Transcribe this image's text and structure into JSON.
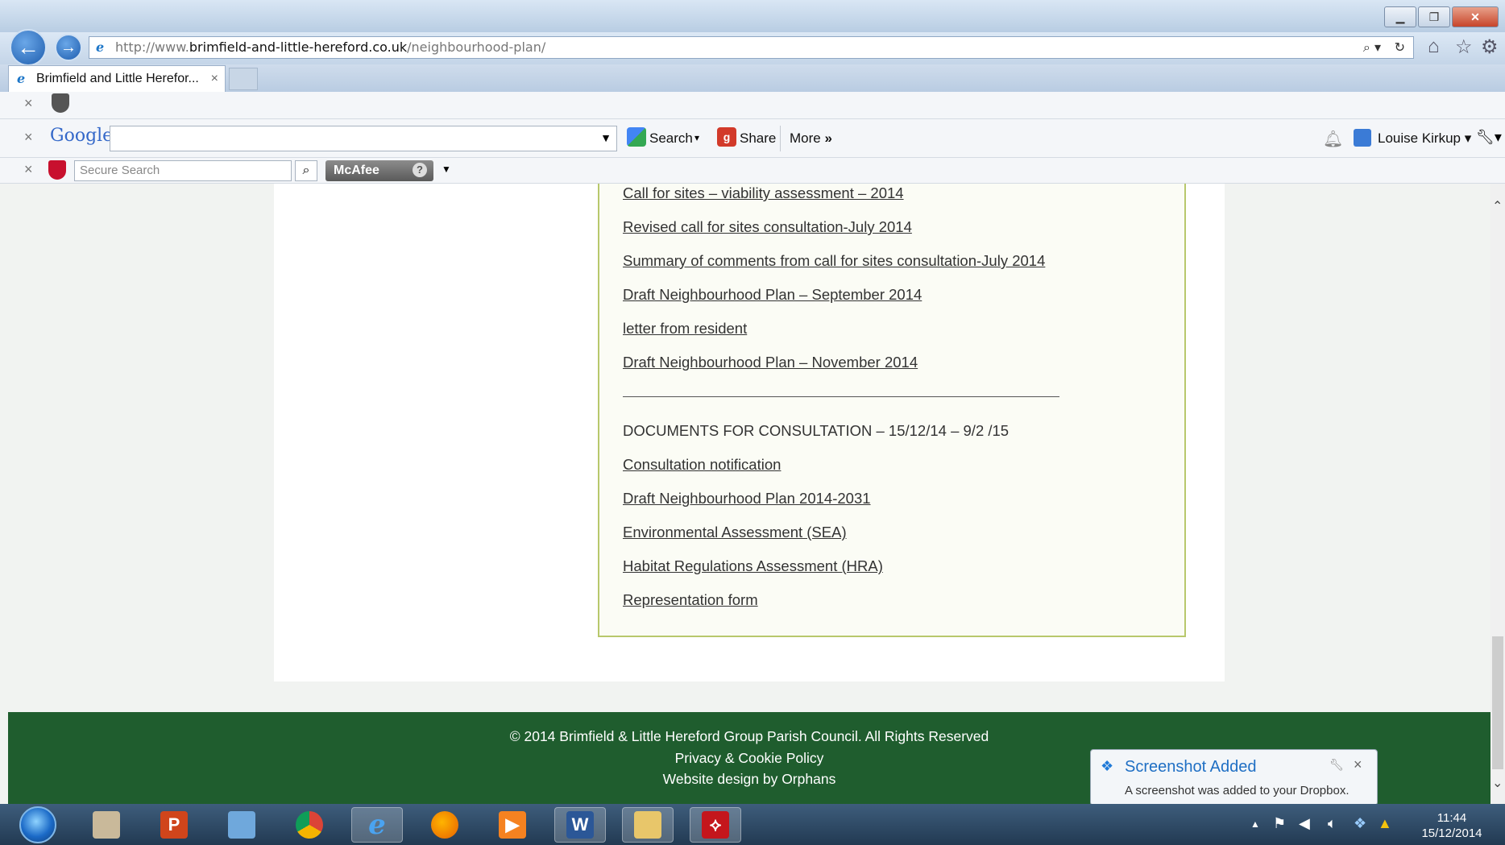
{
  "browser": {
    "url_prefix": "http://www.",
    "url_domain": "brimfield-and-little-hereford.co.uk",
    "url_path": "/neighbourhood-plan/",
    "tab_title": "Brimfield and Little Herefor...",
    "tab_close": "×"
  },
  "toolbar": {
    "close_glyph": "×",
    "google_logo": "Google",
    "search_label": "Search",
    "share_label": "Share",
    "more_label": "More",
    "user_name": "Louise Kirkup",
    "secure_search_placeholder": "Secure Search",
    "mcafee_label": "McAfee"
  },
  "content": {
    "links_top": [
      "Call for sites – viability assessment – 2014",
      "Revised call for sites consultation-July 2014",
      "Summary of comments from call for sites consultation-July 2014",
      "Draft Neighbourhood Plan – September 2014",
      "letter from resident",
      "Draft Neighbourhood Plan – November 2014"
    ],
    "section_heading": "DOCUMENTS FOR CONSULTATION – 15/12/14 – 9/2 /15",
    "links_bottom": [
      "Consultation notification",
      "Draft Neighbourhood Plan 2014-2031",
      "Environmental Assessment (SEA)",
      "Habitat Regulations Assessment (HRA)",
      "Representation form"
    ]
  },
  "footer": {
    "copyright": "© 2014 Brimfield & Little Hereford Group Parish Council. All Rights Reserved",
    "privacy": "Privacy & Cookie Policy",
    "design": "Website design by Orphans"
  },
  "notification": {
    "title": "Screenshot Added",
    "body": "A screenshot was added to your Dropbox."
  },
  "taskbar": {
    "time": "11:44",
    "date": "15/12/2014"
  }
}
